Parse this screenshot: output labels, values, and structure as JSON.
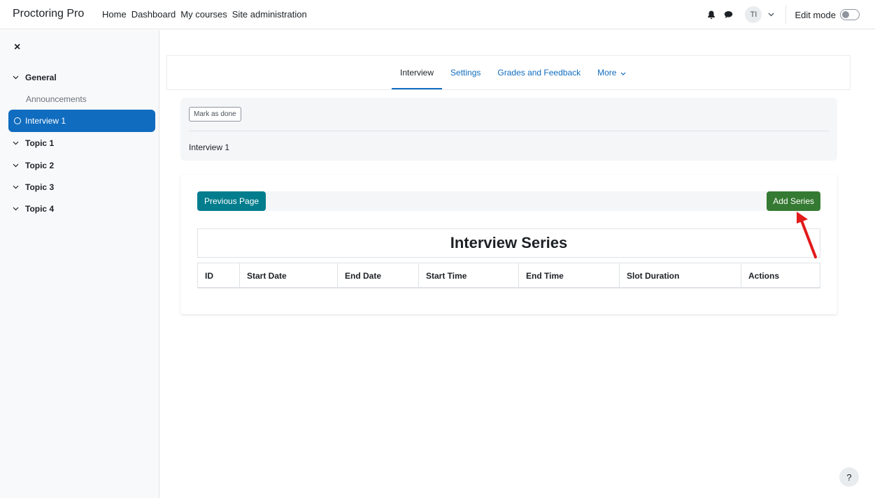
{
  "navbar": {
    "brand": "Proctoring Pro",
    "links": [
      "Home",
      "Dashboard",
      "My courses",
      "Site administration"
    ],
    "avatar_initials": "TI",
    "edit_mode_label": "Edit mode",
    "icons": [
      "bell-icon",
      "chat-icon",
      "chevron-down-icon"
    ]
  },
  "sidebar": {
    "close_icon": "close-icon",
    "sections": [
      {
        "label": "General",
        "expanded": true
      },
      {
        "label": "Announcements"
      },
      {
        "label": "Interview 1",
        "active": true
      },
      {
        "label": "Topic 1"
      },
      {
        "label": "Topic 2"
      },
      {
        "label": "Topic 3"
      },
      {
        "label": "Topic 4"
      }
    ]
  },
  "secondary_nav": {
    "tabs": [
      "Interview",
      "Settings",
      "Grades and Feedback",
      "More"
    ],
    "active_tab": "Interview"
  },
  "activity": {
    "mark_done_label": "Mark as done",
    "title": "Interview 1"
  },
  "content": {
    "previous_button": "Previous Page",
    "add_button": "Add Series",
    "table_title": "Interview Series",
    "columns": [
      "ID",
      "Start Date",
      "End Date",
      "Start Time",
      "End Time",
      "Slot Duration",
      "Actions"
    ]
  },
  "help_label": "?",
  "colors": {
    "primary": "#0f6cbf",
    "teal_button": "#027d8d",
    "green_button": "#357a32",
    "annotation_arrow": "#e21b1b"
  }
}
